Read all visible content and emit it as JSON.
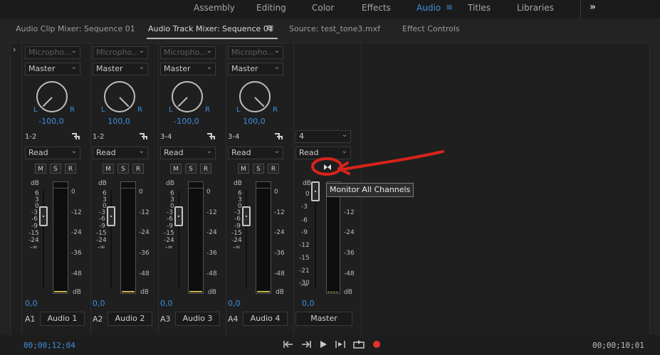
{
  "workspaces": [
    "Assembly",
    "Editing",
    "Color",
    "Effects",
    "Audio",
    "Titles",
    "Libraries"
  ],
  "active_workspace": "Audio",
  "workspace_menu_icon": "hamburger-icon",
  "overflow_icon": "double-chevron-right-icon",
  "tabs": {
    "audio_clip_mixer": "Audio Clip Mixer: Sequence 01",
    "audio_track_mixer": "Audio Track Mixer: Sequence 01",
    "source": "Source: test_tone3.mxf",
    "effect_controls": "Effect Controls"
  },
  "tracks": [
    {
      "input": "Micropho...",
      "output": "Master",
      "pan_value": "-100,0",
      "route": "1-2",
      "automation": "Read",
      "volume": "0,0",
      "id": "A1",
      "name": "Audio 1"
    },
    {
      "input": "Micropho...",
      "output": "Master",
      "pan_value": "100,0",
      "route": "1-2",
      "automation": "Read",
      "volume": "0,0",
      "id": "A2",
      "name": "Audio 2"
    },
    {
      "input": "Micropho...",
      "output": "Master",
      "pan_value": "-100,0",
      "route": "3-4",
      "automation": "Read",
      "volume": "0,0",
      "id": "A3",
      "name": "Audio 3"
    },
    {
      "input": "Micropho...",
      "output": "Master",
      "pan_value": "100,0",
      "route": "3-4",
      "automation": "Read",
      "volume": "0,0",
      "id": "A4",
      "name": "Audio 4"
    }
  ],
  "master": {
    "channels": "4",
    "automation": "Read",
    "volume": "0,0",
    "name": "Master"
  },
  "knob_labels": {
    "left": "L",
    "right": "R"
  },
  "msr": {
    "mute": "M",
    "solo": "S",
    "record": "R"
  },
  "fader_scale": [
    "dB",
    "6",
    "3",
    "0",
    "-3",
    "-6",
    "-9",
    "-15",
    "-24",
    "-∞"
  ],
  "master_fader_scale": [
    "dB",
    "0",
    "-3",
    "-6",
    "-9",
    "-12",
    "-15",
    "-21",
    "-30",
    "-∞"
  ],
  "meter_scale": [
    "0",
    "-12",
    "-24",
    "-36",
    "-48",
    "dB"
  ],
  "tooltip": "Monitor All Channels",
  "timecode_current": "00;00;12;04",
  "timecode_duration": "00;00;10;01",
  "colors": {
    "accent": "#3f8fe0",
    "annotation": "#d8231c",
    "record": "#e0332a"
  }
}
